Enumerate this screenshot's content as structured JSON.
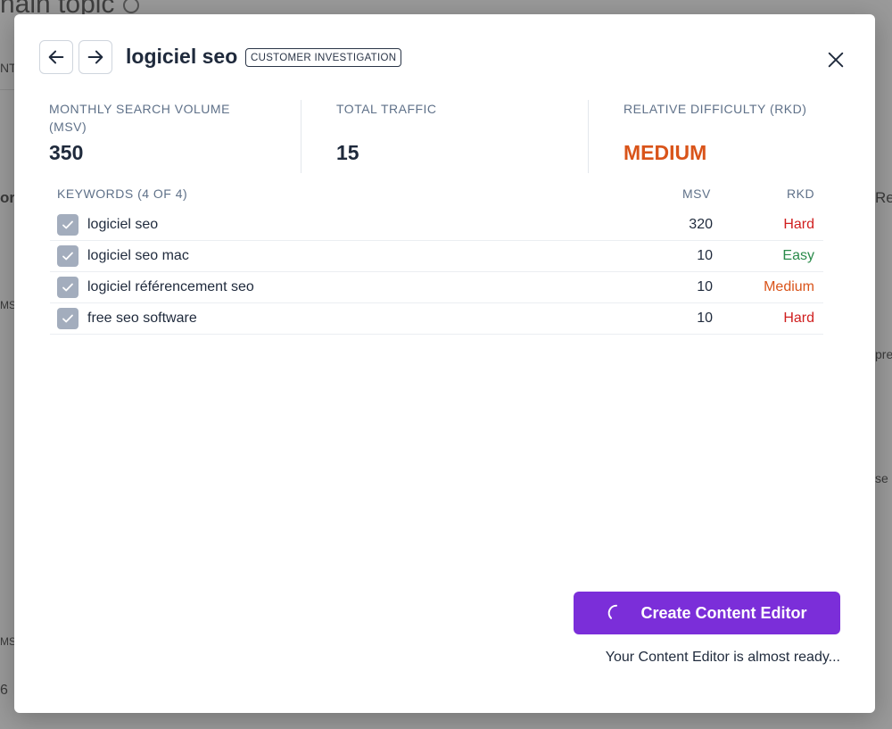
{
  "background": {
    "heading": "nain topic",
    "fragments": [
      "NT",
      "or",
      "MS",
      "Rel",
      "pre",
      "se",
      "MS",
      "6"
    ]
  },
  "modal": {
    "title": "logiciel seo",
    "intent_badge": "CUSTOMER INVESTIGATION",
    "metrics": [
      {
        "label": "MONTHLY SEARCH VOLUME (MSV)",
        "value": "350"
      },
      {
        "label": "TOTAL TRAFFIC",
        "value": "15"
      },
      {
        "label": "RELATIVE DIFFICULTY (RKD)",
        "value": "MEDIUM"
      }
    ],
    "keywords": {
      "header_label": "KEYWORDS (4 OF 4)",
      "col_msv": "MSV",
      "col_rkd": "RKD",
      "rows": [
        {
          "keyword": "logiciel seo",
          "msv": "320",
          "rkd": "Hard",
          "checked": true
        },
        {
          "keyword": "logiciel seo mac",
          "msv": "10",
          "rkd": "Easy",
          "checked": true
        },
        {
          "keyword": "logiciel référencement seo",
          "msv": "10",
          "rkd": "Medium",
          "checked": true
        },
        {
          "keyword": "free seo software",
          "msv": "10",
          "rkd": "Hard",
          "checked": true
        }
      ]
    },
    "create_button_label": "Create Content Editor",
    "status_text": "Your Content Editor is almost ready..."
  },
  "colors": {
    "accent": "#7b2ed9",
    "medium": "#d9541a",
    "hard": "#d01f1f",
    "easy": "#2a8a4a",
    "checkbox": "#a3adbd"
  },
  "icons": [
    "arrow-left-icon",
    "arrow-right-icon",
    "close-icon",
    "check-icon",
    "spinner-icon",
    "info-icon"
  ]
}
